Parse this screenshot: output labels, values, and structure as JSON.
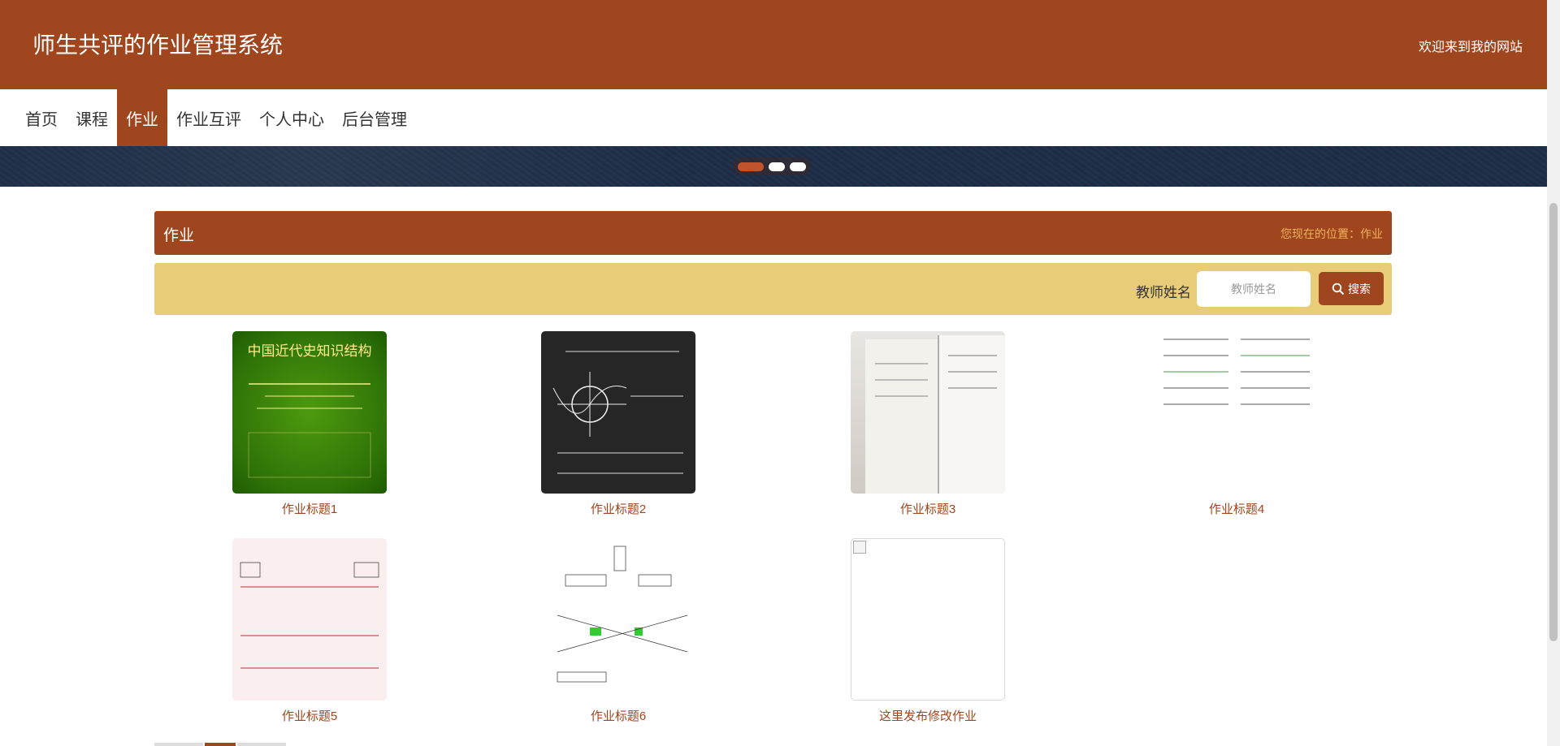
{
  "header": {
    "title": "师生共评的作业管理系统",
    "welcome": "欢迎来到我的网站"
  },
  "nav": {
    "items": [
      {
        "label": "首页"
      },
      {
        "label": "课程"
      },
      {
        "label": "作业"
      },
      {
        "label": "作业互评"
      },
      {
        "label": "个人中心"
      },
      {
        "label": "后台管理"
      }
    ],
    "active_index": 2
  },
  "banner": {
    "slide_count": 3,
    "active_slide": 0
  },
  "section": {
    "title": "作业",
    "breadcrumb": "您现在的位置：作业"
  },
  "search": {
    "label": "教师姓名",
    "placeholder": "教师姓名",
    "value": "",
    "button_label": "搜索",
    "button_icon": "search-icon"
  },
  "assignments": [
    {
      "title": "作业标题1",
      "thumbnail": "中国近代史知识结构"
    },
    {
      "title": "作业标题2",
      "thumbnail": "math-formulas-blackboard"
    },
    {
      "title": "作业标题3",
      "thumbnail": "notebook-photo"
    },
    {
      "title": "作业标题4",
      "thumbnail": "vocabulary-list"
    },
    {
      "title": "作业标题5",
      "thumbnail": "history-timeline-chart"
    },
    {
      "title": "作业标题6",
      "thumbnail": "flow-diagram"
    },
    {
      "title": "这里发布修改作业",
      "thumbnail": "broken-image"
    }
  ],
  "colors": {
    "brand": "#a0461f",
    "search_bar": "#e8cc78",
    "breadcrumb": "#f0b15a",
    "banner": "#1f2e46"
  }
}
